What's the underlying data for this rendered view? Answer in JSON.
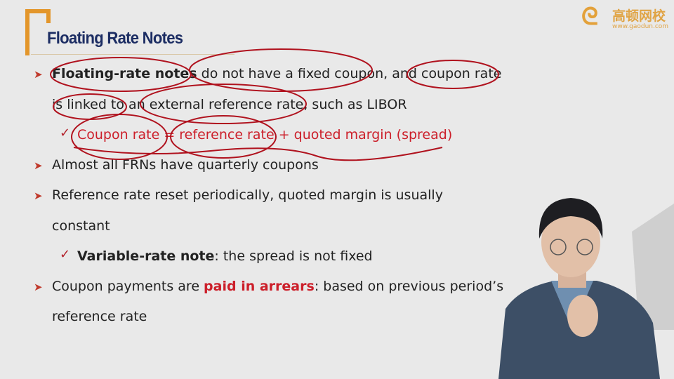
{
  "slide": {
    "title": "Floating Rate Notes",
    "logo": {
      "name": "高顿网校",
      "url": "www.gaodun.com"
    },
    "bullets": [
      {
        "bold": "Floating-rate notes",
        "text": " do not have a fixed coupon, and coupon rate",
        "cont": "is linked to an external reference rate, such as LIBOR"
      },
      {
        "sub": "Coupon rate = reference rate + quoted margin (spread)"
      },
      {
        "text": "Almost all FRNs have quarterly coupons"
      },
      {
        "text": "Reference rate reset periodically, quoted margin is usually",
        "cont": "constant"
      },
      {
        "bold": "Variable-rate note",
        "text": ": the spread is not fixed"
      },
      {
        "text": "Coupon payments are ",
        "highlight": "paid in arrears",
        "text2": ": based on previous period’s",
        "cont": "reference rate"
      }
    ]
  },
  "colors": {
    "title": "#1c2d63",
    "accent": "#e3962b",
    "highlight": "#cc1f2a",
    "ink": "#b0121e"
  },
  "icons": {
    "bullet": "arrow-right-icon",
    "sub_bullet": "checkmark-icon"
  }
}
